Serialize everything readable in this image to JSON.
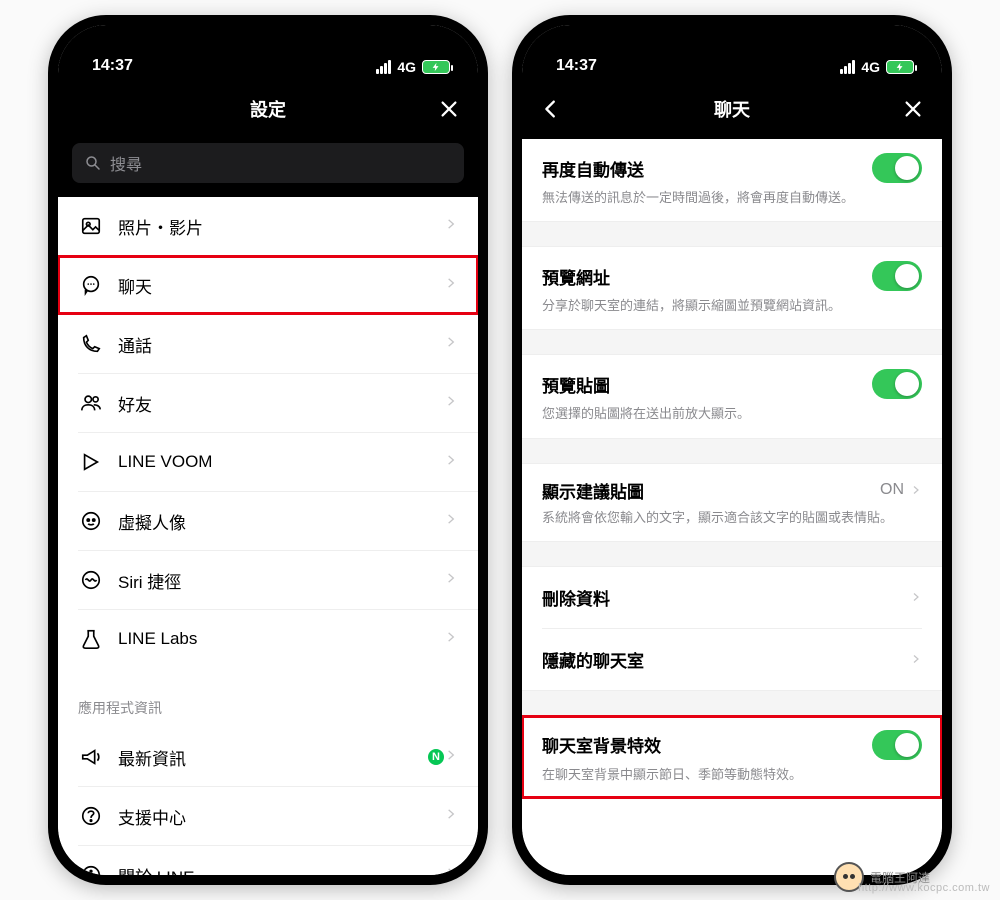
{
  "status": {
    "time": "14:37",
    "network": "4G"
  },
  "left": {
    "title": "設定",
    "search_placeholder": "搜尋",
    "items": [
      {
        "icon": "image-video-icon",
        "label": "照片・影片"
      },
      {
        "icon": "chat-icon",
        "label": "聊天",
        "highlight": true
      },
      {
        "icon": "call-icon",
        "label": "通話"
      },
      {
        "icon": "friends-icon",
        "label": "好友"
      },
      {
        "icon": "voom-icon",
        "label": "LINE VOOM"
      },
      {
        "icon": "avatar-icon",
        "label": "虛擬人像"
      },
      {
        "icon": "siri-icon",
        "label": "Siri 捷徑"
      },
      {
        "icon": "labs-icon",
        "label": "LINE Labs"
      }
    ],
    "section2_title": "應用程式資訊",
    "items2": [
      {
        "icon": "megaphone-icon",
        "label": "最新資訊",
        "badge": "N"
      },
      {
        "icon": "help-icon",
        "label": "支援中心"
      },
      {
        "icon": "info-icon",
        "label": "關於 LINE"
      }
    ]
  },
  "right": {
    "title": "聊天",
    "settings": [
      {
        "title": "再度自動傳送",
        "sub": "無法傳送的訊息於一定時間過後，將會再度自動傳送。",
        "type": "toggle",
        "on": true
      },
      {
        "title": "預覽網址",
        "sub": "分享於聊天室的連結，將顯示縮圖並預覽網站資訊。",
        "type": "toggle",
        "on": true
      },
      {
        "title": "預覽貼圖",
        "sub": "您選擇的貼圖將在送出前放大顯示。",
        "type": "toggle",
        "on": true
      },
      {
        "title": "顯示建議貼圖",
        "sub": "系統將會依您輸入的文字，顯示適合該文字的貼圖或表情貼。",
        "type": "nav",
        "value": "ON"
      },
      {
        "title": "刪除資料",
        "type": "nav"
      },
      {
        "title": "隱藏的聊天室",
        "type": "nav"
      },
      {
        "title": "聊天室背景特效",
        "sub": "在聊天室背景中顯示節日、季節等動態特效。",
        "type": "toggle",
        "on": true,
        "highlight": true
      }
    ]
  },
  "watermark": "http://www.kocpc.com.tw",
  "mascot_text": "電腦王阿達"
}
